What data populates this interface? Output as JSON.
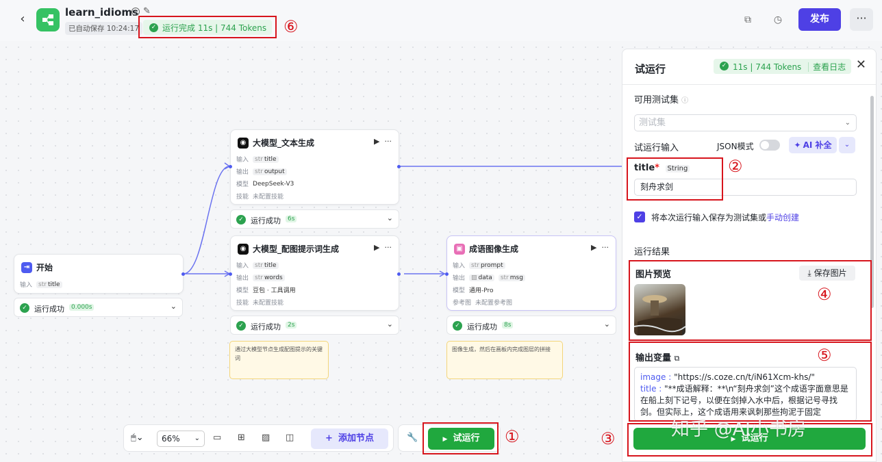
{
  "header": {
    "app_title": "learn_idioms",
    "autosave": "已自动保存 10:24:17",
    "run_status": "运行完成 11s | 744 Tokens",
    "publish": "发布",
    "more": "···"
  },
  "annotations": [
    "①",
    "②",
    "③",
    "④",
    "⑤",
    "⑥"
  ],
  "nodes": {
    "start": {
      "title": "开始",
      "input_label": "输入",
      "input_tag_type": "str",
      "input_tag": "title",
      "status": "运行成功",
      "duration": "0.000s"
    },
    "llm_text": {
      "title": "大模型_文本生成",
      "in_label": "输入",
      "in_type": "str",
      "in_tag": "title",
      "out_label": "输出",
      "out_type": "str",
      "out_tag": "output",
      "model_label": "模型",
      "model": "DeepSeek-V3",
      "skill_label": "技能",
      "skill": "未配置技能",
      "status": "运行成功",
      "duration": "6s"
    },
    "llm_prompt": {
      "title": "大模型_配图提示词生成",
      "in_label": "输入",
      "in_type": "str",
      "in_tag": "title",
      "out_label": "输出",
      "out_type": "str",
      "out_tag": "words",
      "model_label": "模型",
      "model": "豆包 · 工具调用",
      "skill_label": "技能",
      "skill": "未配置技能",
      "status": "运行成功",
      "duration": "2s",
      "note": "通过大模型节点生成配图提示的关键词"
    },
    "image_gen": {
      "title": "成语图像生成",
      "in_label": "输入",
      "in_type": "str",
      "in_tag": "prompt",
      "out_label": "输出",
      "out_tag1": "data",
      "out_type2": "str",
      "out_tag2": "msg",
      "model_label": "模型",
      "model": "通用-Pro",
      "ref_label": "参考图",
      "ref": "未配置参考图",
      "status": "运行成功",
      "duration": "8s",
      "note": "图像生成，然后在画板内完成图层的拼接"
    }
  },
  "toolbar": {
    "zoom": "66%",
    "add_node": "添加节点",
    "test_run": "试运行"
  },
  "panel": {
    "title": "试运行",
    "badge_stats": "11s | 744 Tokens",
    "badge_log": "查看日志",
    "test_set_label": "可用测试集",
    "test_set_placeholder": "测试集",
    "run_input_label": "试运行输入",
    "json_mode": "JSON模式",
    "ai_fill": "AI 补全",
    "field_name": "title",
    "field_required": "*",
    "field_type": "String",
    "field_value": "刻舟求剑",
    "save_checkbox_text": "将本次运行输入保存为测试集或",
    "manual_create": "手动创建",
    "results_label": "运行结果",
    "preview_label": "图片预览",
    "save_image": "保存图片",
    "output_vars_label": "输出变量",
    "out_image_key": "image",
    "out_image_val": "\"https://s.coze.cn/t/iN61Xcm-khs/\"",
    "out_title_key": "title",
    "out_title_val": "\"**成语解释：**\\n“刻舟求剑”这个成语字面意思是在船上刻下记号，以便在剑掉入水中后，根据记号寻找剑。但实际上，这个成语用来讽刺那些拘泥于固定",
    "test_run": "试运行"
  },
  "watermark": "知乎 @AI小书房"
}
